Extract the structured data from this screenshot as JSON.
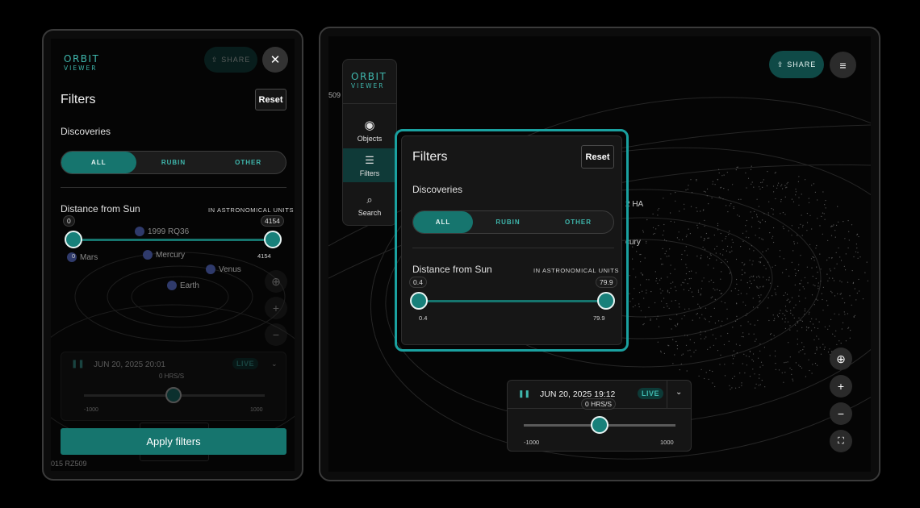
{
  "app": {
    "logo_line1": "ORBIT",
    "logo_line2": "VIEWER"
  },
  "share_label": "SHARE",
  "filters": {
    "title": "Filters",
    "reset_label": "Reset",
    "discoveries_label": "Discoveries",
    "discovery_options": [
      "ALL",
      "RUBIN",
      "OTHER"
    ],
    "selected_discovery": "ALL",
    "distance_label": "Distance from Sun",
    "distance_units": "IN ASTRONOMICAL UNITS"
  },
  "phone": {
    "distance_min": "0",
    "distance_max": "4154",
    "range_low_label": "0",
    "range_high_label": "4154",
    "apply_label": "Apply filters",
    "bodies": [
      "1999 RQ36",
      "Mars",
      "Mercury",
      "Venus",
      "Earth"
    ],
    "time_label": "JUN 20, 2025 20:01",
    "live_label": "LIVE",
    "rate_label": "0 HRS/S",
    "rate_min": "-1000",
    "rate_max": "1000",
    "corner_label": "015 RZ509"
  },
  "tablet": {
    "nav": [
      {
        "label": "Objects",
        "icon": "target-icon"
      },
      {
        "label": "Filters",
        "icon": "sliders-icon"
      },
      {
        "label": "Search",
        "icon": "search-icon"
      }
    ],
    "distance_min": "0.4",
    "distance_max": "79.9",
    "range_low_label": "0.4",
    "range_high_label": "79.9",
    "edge_labels": [
      "509",
      "2 HA",
      "cury"
    ],
    "time_label": "JUN 20, 2025 19:12",
    "live_label": "LIVE",
    "rate_label": "0 HRS/S",
    "rate_min": "-1000",
    "rate_max": "1000"
  },
  "colors": {
    "accent": "#16756e",
    "accent_text": "#3fb7ad",
    "highlight": "#1aa1a0"
  }
}
